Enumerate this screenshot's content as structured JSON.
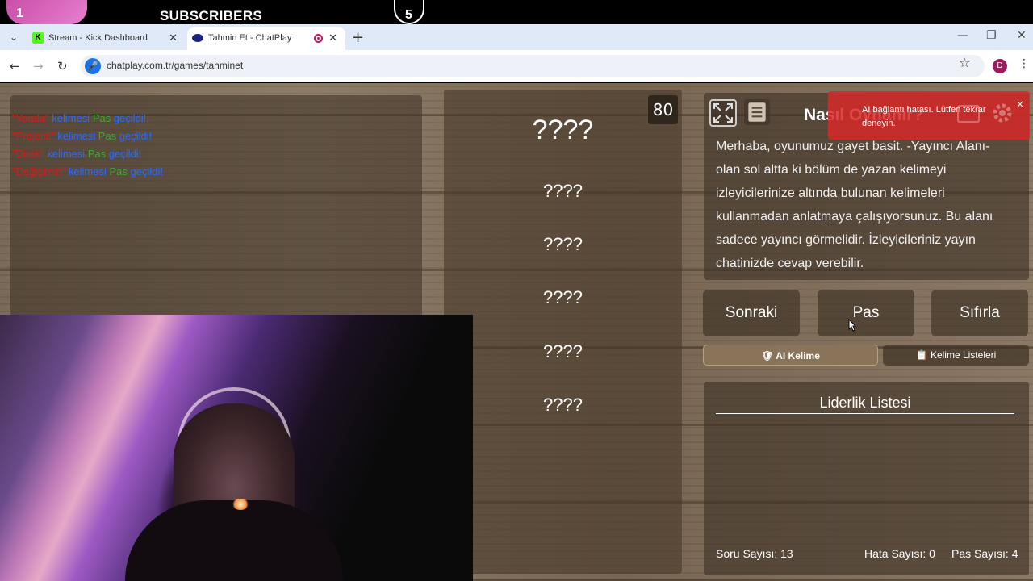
{
  "overlay": {
    "rank": "1",
    "label": "SUBSCRIBERS",
    "count": "5"
  },
  "tabs": [
    {
      "title": "Stream - Kick Dashboard",
      "icon": "kick-icon"
    },
    {
      "title": "Tahmin Et - ChatPlay",
      "icon": "chatplay-icon",
      "active": true
    }
  ],
  "address": {
    "url": "chatplay.com.tr/games/tahminet",
    "avatar_letter": "D"
  },
  "chat": [
    {
      "word": "\"Yorulu\"",
      "mid": " kelimesi ",
      "pass": "Pas",
      "end": " geçildi!"
    },
    {
      "word": "\"Projenil\"",
      "mid": " kelimesi ",
      "pass": "Pas",
      "end": " geçildi!"
    },
    {
      "word": "\"Direk\"",
      "mid": " kelimesi ",
      "pass": "Pas",
      "end": " geçildi!"
    },
    {
      "word": "\"Değişimin\"",
      "mid": " kelimesi ",
      "pass": "Pas",
      "end": " geçildi!"
    }
  ],
  "words": {
    "counter": "80",
    "main": "????",
    "items": [
      "????",
      "????",
      "????",
      "????",
      "????"
    ]
  },
  "info": {
    "title": "Nasıl Oynanır?",
    "text": "Merhaba, oyunumuz gayet basit. -Yayıncı Alanı- olan sol altta ki bölüm de yazan kelimeyi izleyicilerinize altında bulunan kelimeleri kullanmadan anlatmaya çalışıyorsunuz. Bu alanı sadece yayıncı görmelidir. İzleyicileriniz yayın chatinizde cevap verebilir."
  },
  "toast": {
    "text": "AI bağlantı hatası. Lütfen tekrar deneyin.",
    "close": "×"
  },
  "buttons": {
    "next": "Sonraki",
    "pass": "Pas",
    "reset": "Sıfırla",
    "ai_word": "AI Kelime",
    "word_lists": "Kelime Listeleri"
  },
  "leaderboard": {
    "title": "Liderlik Listesi",
    "question_count": "Soru Sayısı: 13",
    "error_count": "Hata Sayısı: 0",
    "pass_count": "Pas Sayısı: 4"
  },
  "colors": {
    "word_red": "#d81b1b",
    "word_blue": "#2a6bff",
    "word_green": "#3fa832",
    "toast_red": "#d62828"
  }
}
